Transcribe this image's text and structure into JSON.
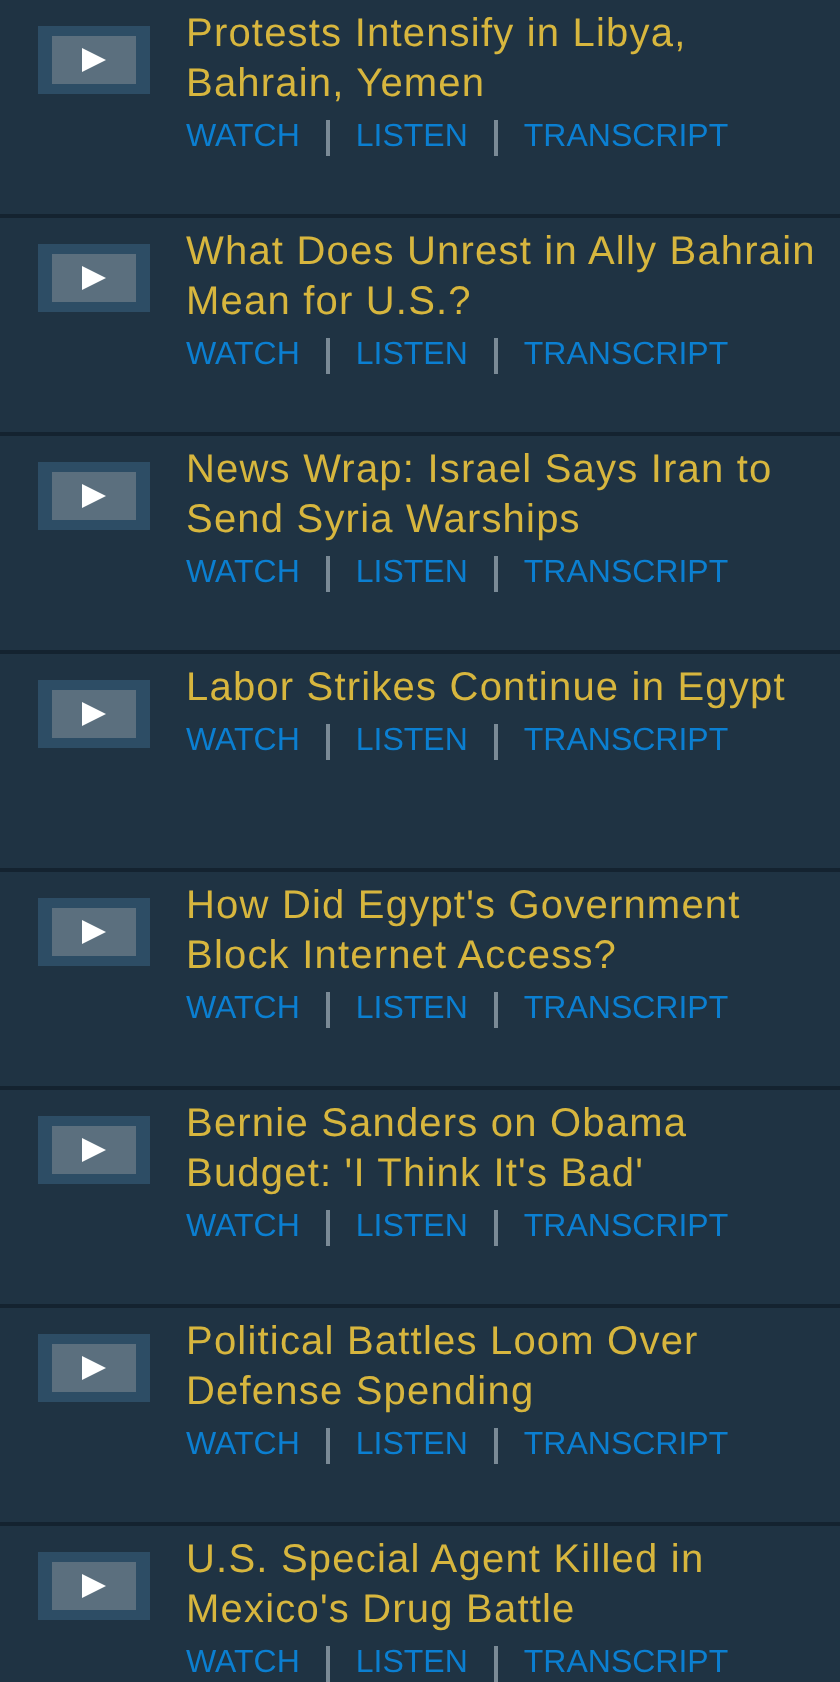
{
  "stories": [
    {
      "title": "Protests Intensify in Libya, Bahrain, Yemen",
      "links": [
        "WATCH",
        "LISTEN",
        "TRANSCRIPT"
      ]
    },
    {
      "title": "What Does Unrest in Ally Bahrain Mean for U.S.?",
      "links": [
        "WATCH",
        "LISTEN",
        "TRANSCRIPT"
      ]
    },
    {
      "title": "News Wrap: Israel Says Iran to Send Syria Warships",
      "links": [
        "WATCH",
        "LISTEN",
        "TRANSCRIPT"
      ]
    },
    {
      "title": "Labor Strikes Continue in Egypt",
      "links": [
        "WATCH",
        "LISTEN",
        "TRANSCRIPT"
      ]
    },
    {
      "title": "How Did Egypt's Government Block Internet Access?",
      "links": [
        "WATCH",
        "LISTEN",
        "TRANSCRIPT"
      ]
    },
    {
      "title": "Bernie Sanders on Obama Budget: 'I Think It's Bad'",
      "links": [
        "WATCH",
        "LISTEN",
        "TRANSCRIPT"
      ]
    },
    {
      "title": "Political Battles Loom Over Defense Spending",
      "links": [
        "WATCH",
        "LISTEN",
        "TRANSCRIPT"
      ]
    },
    {
      "title": "U.S. Special Agent Killed in Mexico's Drug Battle",
      "links": [
        "WATCH",
        "LISTEN",
        "TRANSCRIPT"
      ]
    }
  ]
}
